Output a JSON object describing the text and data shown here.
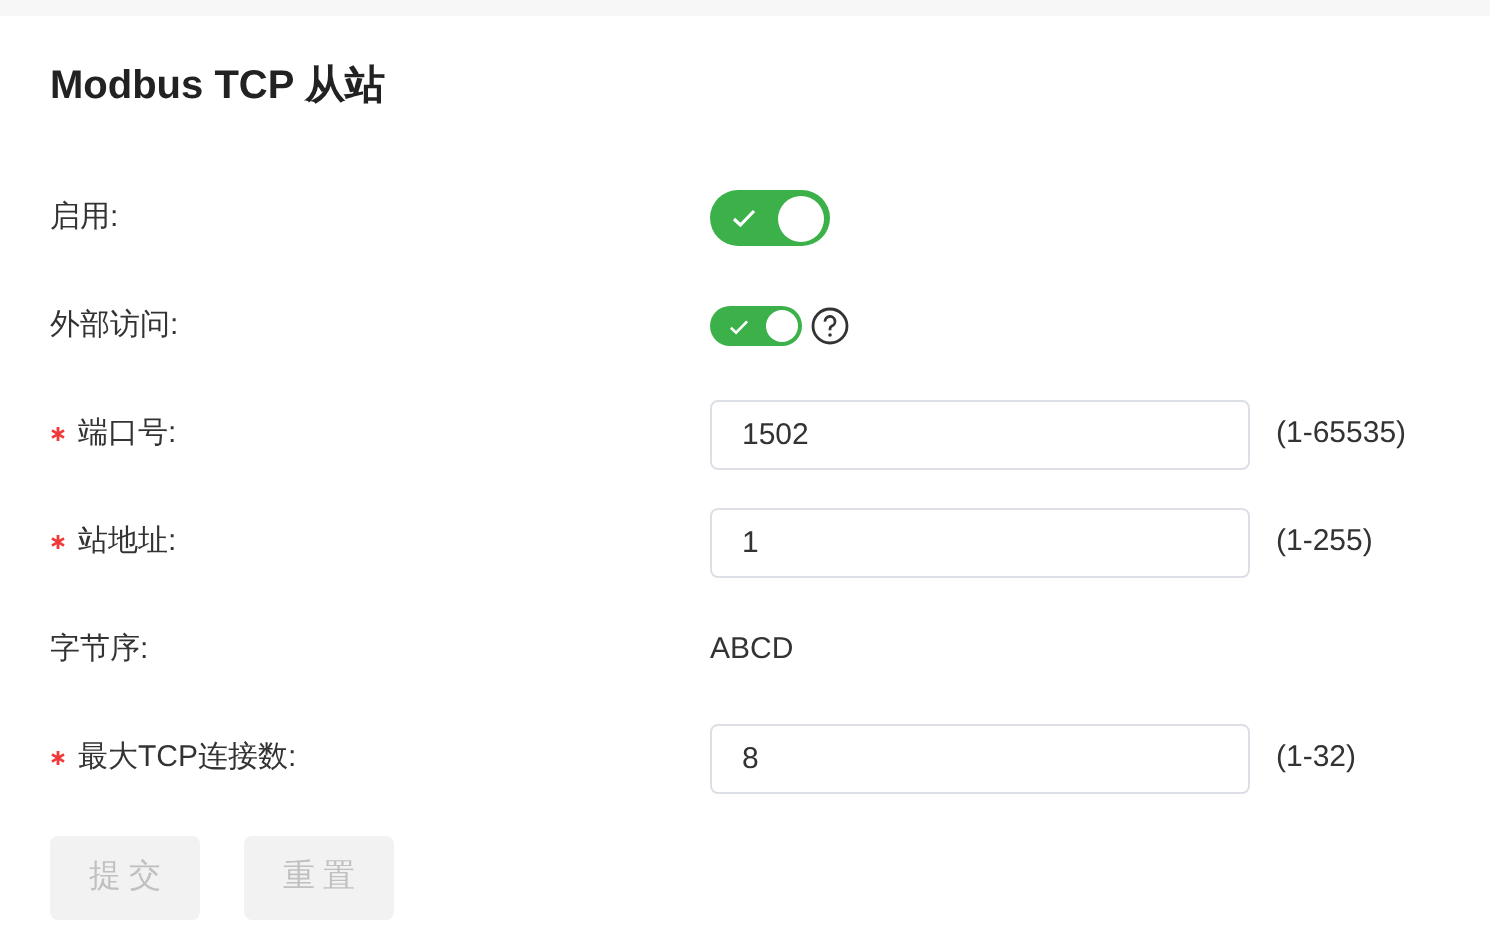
{
  "title": "Modbus TCP 从站",
  "fields": [
    {
      "kind": "switch",
      "label": "启用:",
      "required": false,
      "on": true,
      "help": false
    },
    {
      "kind": "small-switch",
      "label": "外部访问:",
      "required": false,
      "on": true,
      "help": true
    },
    {
      "kind": "input",
      "label": "端口号:",
      "required": true,
      "value": "1502",
      "hint": "(1-65535)"
    },
    {
      "kind": "input",
      "label": "站地址:",
      "required": true,
      "value": "1",
      "hint": "(1-255)"
    },
    {
      "kind": "text",
      "label": "字节序:",
      "required": false,
      "value": "ABCD"
    },
    {
      "kind": "input",
      "label": "最大TCP连接数:",
      "required": true,
      "value": "8",
      "hint": "(1-32)"
    }
  ],
  "buttons": [
    {
      "label": "提 交",
      "disabled": true
    },
    {
      "label": "重 置",
      "disabled": true
    }
  ]
}
